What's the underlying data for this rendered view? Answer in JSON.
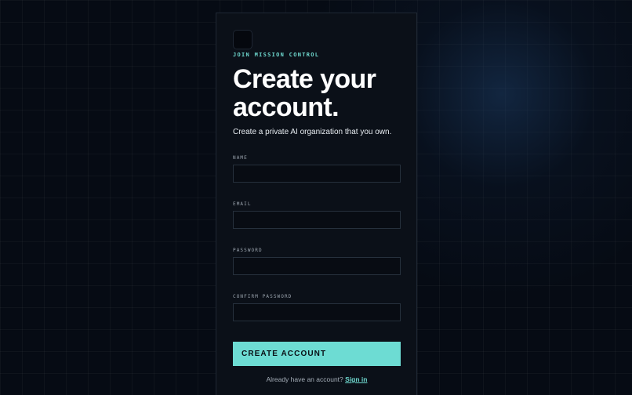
{
  "brand": {
    "eyebrow": "JOIN MISSION CONTROL"
  },
  "heading": {
    "title": "Create your account.",
    "subtitle": "Create a private AI organization that you own."
  },
  "form": {
    "name_label": "NAME",
    "name_value": "",
    "email_label": "EMAIL",
    "email_value": "",
    "password_label": "PASSWORD",
    "password_value": "",
    "confirm_label": "CONFIRM PASSWORD",
    "confirm_value": "",
    "submit_label": "CREATE ACCOUNT"
  },
  "footer": {
    "prompt": "Already have an account?",
    "link_label": "Sign in"
  },
  "colors": {
    "accent": "#6ddcd3",
    "background": "#060b14",
    "card": "#0b1018"
  }
}
